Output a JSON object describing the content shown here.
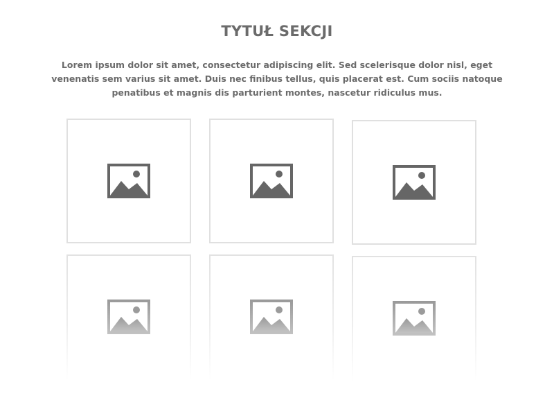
{
  "section": {
    "title": "TYTUŁ SEKCJI",
    "description": "Lorem ipsum dolor sit amet, consectetur adipiscing elit. Sed scelerisque dolor nisl, eget venenatis sem varius sit amet. Duis nec finibus tellus, quis placerat est. Cum sociis natoque penatibus et magnis dis parturient montes, nascetur ridiculus mus."
  },
  "grid": {
    "rows": 2,
    "columns": 3,
    "tiles": [
      {
        "icon": "image-placeholder-icon"
      },
      {
        "icon": "image-placeholder-icon"
      },
      {
        "icon": "image-placeholder-icon"
      },
      {
        "icon": "image-placeholder-icon"
      },
      {
        "icon": "image-placeholder-icon"
      },
      {
        "icon": "image-placeholder-icon"
      }
    ]
  },
  "colors": {
    "text": "#6b6b6b",
    "tile_border": "#e0e0e0",
    "icon_dark": "#666666",
    "icon_faded": "#9a9a9a"
  }
}
